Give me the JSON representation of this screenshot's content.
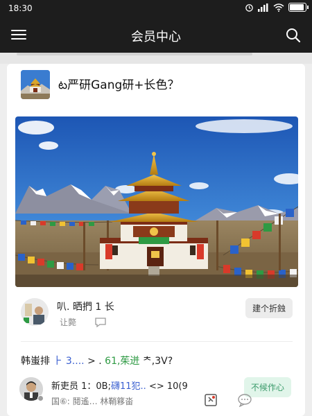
{
  "status_bar": {
    "time": "18:30",
    "battery_level": 0.9
  },
  "nav": {
    "title": "会员中心"
  },
  "post": {
    "title": "ట严研Gang研+长色？"
  },
  "reply": {
    "name": "叭. 晒捫 1 长",
    "meta": "让斃",
    "chip_label": "建个折鉵"
  },
  "rank_line": {
    "part1": "韩蚩排",
    "part2": "⺊ 3....",
    "part3": "> .",
    "part4": "61,茱迸",
    "part5": "ᄎ,3V?"
  },
  "member": {
    "name_prefix": "新吏员 1：0B;",
    "name_link": "礴11犯..",
    "name_suffix": "<> 10(9",
    "sub": "国⑥: 鬩遙… 林鞘簃畓",
    "chip_label": "不候作心"
  },
  "colors": {
    "bar_bg": "#1d1d1d",
    "link": "#3a5fd0",
    "green": "#2e9a43",
    "chip_green_bg": "#e1f5ea",
    "chip_green_text": "#3a9a6a"
  },
  "icons": {
    "menu": "menu-icon",
    "search": "search-icon",
    "comment": "comment-icon",
    "bookmark": "bookmark-icon",
    "chat": "chat-icon"
  }
}
